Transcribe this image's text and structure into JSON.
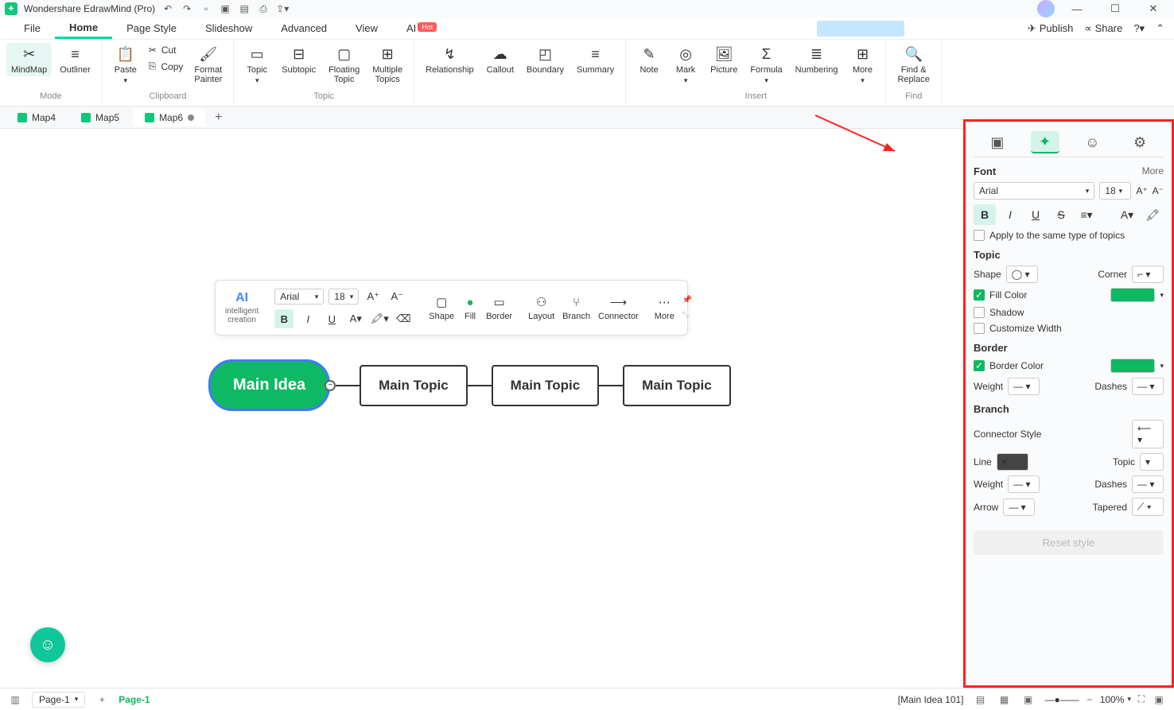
{
  "app": {
    "title": "Wondershare EdrawMind (Pro)"
  },
  "menubar": {
    "items": [
      "File",
      "Home",
      "Page Style",
      "Slideshow",
      "Advanced",
      "View",
      "AI"
    ],
    "active": 1,
    "hot_badge": "Hot",
    "publish": "Publish",
    "share": "Share"
  },
  "ribbon": {
    "mode": {
      "mindmap": "MindMap",
      "outliner": "Outliner",
      "group": "Mode"
    },
    "clipboard": {
      "paste": "Paste",
      "cut": "Cut",
      "copy": "Copy",
      "format_painter": "Format\nPainter",
      "group": "Clipboard"
    },
    "topic": {
      "topic": "Topic",
      "subtopic": "Subtopic",
      "floating": "Floating\nTopic",
      "multiple": "Multiple\nTopics",
      "group": "Topic"
    },
    "relations": {
      "relationship": "Relationship",
      "callout": "Callout",
      "boundary": "Boundary",
      "summary": "Summary"
    },
    "insert": {
      "note": "Note",
      "mark": "Mark",
      "picture": "Picture",
      "formula": "Formula",
      "numbering": "Numbering",
      "more": "More",
      "group": "Insert"
    },
    "find": {
      "find_replace": "Find &\nReplace",
      "group": "Find"
    }
  },
  "tabs": {
    "items": [
      "Map4",
      "Map5",
      "Map6"
    ],
    "active": 2
  },
  "float_toolbar": {
    "ai": "AI",
    "ai_sub": "intelligent\ncreation",
    "font": "Arial",
    "size": "18",
    "shape": "Shape",
    "fill": "Fill",
    "border": "Border",
    "layout": "Layout",
    "branch": "Branch",
    "connector": "Connector",
    "more": "More"
  },
  "mindmap": {
    "main": "Main Idea",
    "topics": [
      "Main Topic",
      "Main Topic",
      "Main Topic"
    ]
  },
  "right_panel": {
    "font": {
      "title": "Font",
      "more": "More",
      "family": "Arial",
      "size": "18",
      "apply_same": "Apply to the same type of topics"
    },
    "topic": {
      "title": "Topic",
      "shape": "Shape",
      "corner": "Corner",
      "fill_color": "Fill Color",
      "shadow": "Shadow",
      "customize_width": "Customize Width"
    },
    "border": {
      "title": "Border",
      "border_color": "Border Color",
      "weight": "Weight",
      "dashes": "Dashes"
    },
    "branch": {
      "title": "Branch",
      "connector_style": "Connector Style",
      "line": "Line",
      "topic": "Topic",
      "weight": "Weight",
      "dashes": "Dashes",
      "arrow": "Arrow",
      "tapered": "Tapered"
    },
    "reset": "Reset style"
  },
  "statusbar": {
    "page_sel": "Page-1",
    "page2": "Page-1",
    "selection": "[Main Idea 101]",
    "zoom": "100%"
  }
}
